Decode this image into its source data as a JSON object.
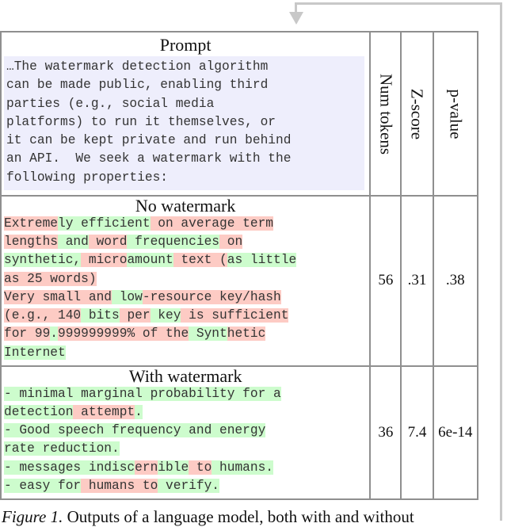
{
  "figure": {
    "columns": {
      "main": "Prompt",
      "num_tokens": "Num tokens",
      "z_score": "Z-score",
      "p_value": "p-value"
    },
    "prompt": {
      "lines": [
        "…The watermark detection algorithm",
        "can be made public, enabling third",
        "parties (e.g., social media",
        "platforms) to run it themselves, or",
        "it can be kept private and run behind",
        "an API.  We seek a watermark with the",
        "following properties:"
      ]
    },
    "rows": [
      {
        "title": "No watermark",
        "num_tokens": "56",
        "z_score": ".31",
        "p_value": ".38",
        "lines": [
          [
            [
              "r",
              "Extreme"
            ],
            [
              "g",
              "ly efficient"
            ],
            [
              "r",
              " on average term"
            ]
          ],
          [
            [
              "r",
              "lengths"
            ],
            [
              "g",
              " and"
            ],
            [
              "r",
              " word"
            ],
            [
              "g",
              " frequencies"
            ],
            [
              "r",
              " on"
            ]
          ],
          [
            [
              "g",
              "synthetic,"
            ],
            [
              "r",
              " micro"
            ],
            [
              "g",
              "amount"
            ],
            [
              "r",
              " text ("
            ],
            [
              "g",
              "as little"
            ]
          ],
          [
            [
              "r",
              "as 25 words)"
            ]
          ],
          [
            [
              "r",
              "Very small and"
            ],
            [
              "g",
              " low"
            ],
            [
              "r",
              "-resource key/hash"
            ]
          ],
          [
            [
              "r",
              "(e.g., 140"
            ],
            [
              "g",
              " bits"
            ],
            [
              "r",
              " per"
            ],
            [
              "g",
              " key"
            ],
            [
              "r",
              " is sufficient"
            ]
          ],
          [
            [
              "r",
              "for 99"
            ],
            [
              "g",
              "."
            ],
            [
              "r",
              "999999999% of the"
            ],
            [
              "g",
              " Synt"
            ],
            [
              "r",
              "hetic"
            ]
          ],
          [
            [
              "g",
              "Internet"
            ]
          ]
        ]
      },
      {
        "title": "With watermark",
        "num_tokens": "36",
        "z_score": "7.4",
        "p_value": "6e-14",
        "lines": [
          [
            [
              "g",
              "- minimal marginal probability for a"
            ]
          ],
          [
            [
              "g",
              "detection"
            ],
            [
              "r",
              " attempt"
            ],
            [
              "g",
              "."
            ]
          ],
          [
            [
              "g",
              "- Good speech frequency and energy"
            ]
          ],
          [
            [
              "g",
              "rate reduction."
            ]
          ],
          [
            [
              "g",
              "- messages indisc"
            ],
            [
              "r",
              "ern"
            ],
            [
              "g",
              "ible"
            ],
            [
              "r",
              " to"
            ],
            [
              "g",
              " humans."
            ]
          ],
          [
            [
              "g",
              "- easy for"
            ],
            [
              "r",
              " humans to"
            ],
            [
              "g",
              " verify."
            ]
          ]
        ]
      }
    ],
    "caption": {
      "label": "Figure 1.",
      "text": " Outputs of a language model, both with and without"
    },
    "colors": {
      "green_token": "#cdfccd",
      "red_token": "#fdcbc4",
      "prompt_bg": "#eeeefc",
      "border": "#8f8f8f",
      "arrow": "#c8c8c8"
    }
  }
}
